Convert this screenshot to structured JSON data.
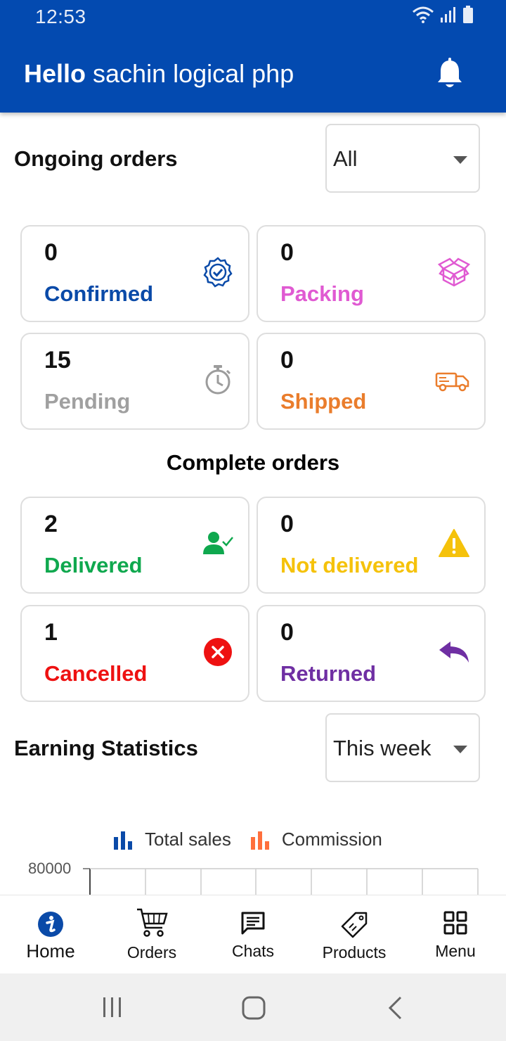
{
  "status_bar": {
    "time": "12:53"
  },
  "header": {
    "greeting_bold": "Hello",
    "user_name": "sachin logical php"
  },
  "ongoing": {
    "title": "Ongoing orders",
    "filter_value": "All",
    "cards": [
      {
        "count": "0",
        "label": "Confirmed",
        "icon": "verified-badge-icon",
        "color": "#0a4aa8"
      },
      {
        "count": "0",
        "label": "Packing",
        "icon": "open-box-icon",
        "color": "#e05ad2"
      },
      {
        "count": "15",
        "label": "Pending",
        "icon": "stopwatch-icon",
        "color": "#a0a0a0"
      },
      {
        "count": "0",
        "label": "Shipped",
        "icon": "delivery-truck-icon",
        "color": "#ea7d2c"
      }
    ]
  },
  "complete": {
    "title": "Complete orders",
    "cards": [
      {
        "count": "2",
        "label": "Delivered",
        "icon": "user-check-icon",
        "color": "#0fa84e"
      },
      {
        "count": "0",
        "label": "Not delivered",
        "icon": "warning-icon",
        "color": "#f5c20b"
      },
      {
        "count": "1",
        "label": "Cancelled",
        "icon": "cancel-circle-icon",
        "color": "#ee1111"
      },
      {
        "count": "0",
        "label": "Returned",
        "icon": "reply-arrow-icon",
        "color": "#6f2fa3"
      }
    ]
  },
  "earnings": {
    "title": "Earning Statistics",
    "period_value": "This week"
  },
  "chart_data": {
    "type": "bar",
    "series": [
      {
        "name": "Total sales",
        "color": "#0a4aa8"
      },
      {
        "name": "Commission",
        "color": "#ff6f3c"
      }
    ],
    "y_ticks": [
      "80000"
    ]
  },
  "bottom_nav": {
    "items": [
      {
        "label": "Home",
        "icon": "home-info-icon"
      },
      {
        "label": "Orders",
        "icon": "shopping-cart-icon"
      },
      {
        "label": "Chats",
        "icon": "chat-icon"
      },
      {
        "label": "Products",
        "icon": "price-tag-icon"
      },
      {
        "label": "Menu",
        "icon": "grid-menu-icon"
      }
    ]
  },
  "colors": {
    "primary": "#034ab0",
    "card_border": "#dedede"
  }
}
